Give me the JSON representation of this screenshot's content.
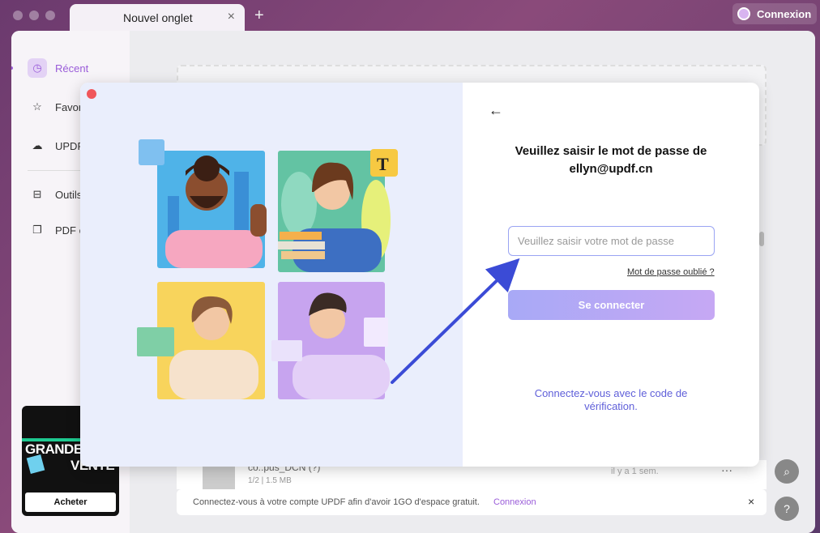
{
  "tab": {
    "title": "Nouvel onglet",
    "close_icon": "×",
    "new_tab_icon": "+"
  },
  "account": {
    "login_label": "Connexion"
  },
  "sidebar": {
    "items": [
      {
        "label": "Récent",
        "icon": "clock-icon",
        "active": true
      },
      {
        "label": "Favor",
        "icon": "star-icon"
      },
      {
        "label": "UPDF",
        "icon": "cloud-icon"
      },
      {
        "label": "Outils",
        "icon": "toolbox-icon"
      },
      {
        "label": "PDF é",
        "icon": "pages-icon"
      }
    ]
  },
  "promo": {
    "line1": "GRANDE",
    "line2": "VENTE",
    "buy_label": "Acheter"
  },
  "file": {
    "name": "co..pus_DCN (?)",
    "meta": "1/2 | 1.5 MB",
    "time": "il y a 1 sem.",
    "more": "···"
  },
  "notice": {
    "text": "Connectez-vous à votre compte UPDF afin d'avoir 1GO d'espace gratuit.",
    "link": "Connexion",
    "close": "×"
  },
  "modal": {
    "back_icon": "←",
    "title": "Veuillez saisir le mot de passe de ellyn@updf.cn",
    "password_placeholder": "Veuillez saisir votre mot de passe",
    "password_value": "",
    "forgot_label": "Mot de passe oublié ?",
    "signin_label": "Se connecter",
    "code_link": "Connectez-vous avec le code de vérification.",
    "text_badge": "T"
  },
  "colors": {
    "accent": "#9a5cd9",
    "button_start": "#a8a9f6",
    "button_end": "#c6a8f4",
    "link": "#5f5fd9",
    "annotation_arrow": "#3b4bd6"
  }
}
